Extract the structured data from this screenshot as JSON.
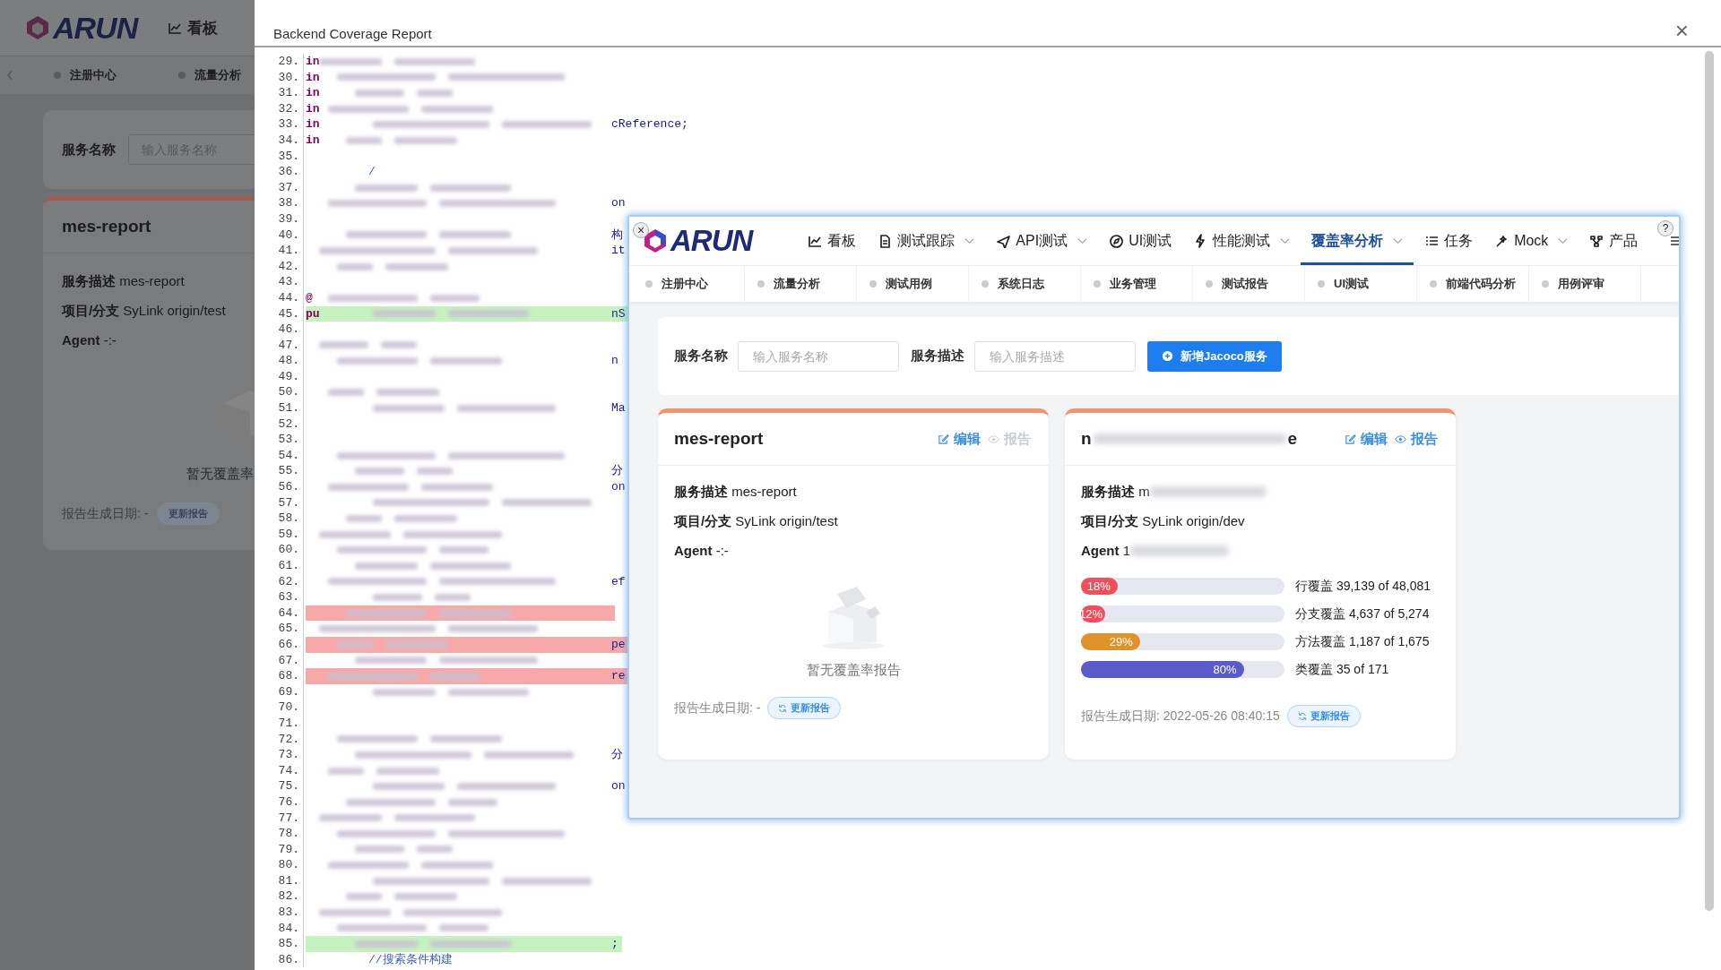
{
  "background_app": {
    "logo": "ARUN",
    "nav_item": "看板",
    "subnav": [
      "注册中心",
      "流量分析"
    ],
    "filter_label": "服务名称",
    "filter_placeholder": "输入服务名称",
    "card": {
      "title": "mes-report",
      "desc_label": "服务描述",
      "desc_value": "mes-report",
      "branch_label": "项目/分支",
      "branch_value": "SyLink origin/test",
      "agent_label": "Agent",
      "agent_value": "-:-",
      "empty_text": "暂无覆盖率",
      "date": "报告生成日期: -",
      "refresh": "更新报告"
    }
  },
  "modal": {
    "title": "Backend Coverage Report",
    "close": "×",
    "code_lines": [
      {
        "no": "29.",
        "head": "in",
        "blurred": true
      },
      {
        "no": "30.",
        "head": "in",
        "blurred": true
      },
      {
        "no": "31.",
        "head": "in",
        "blurred": true
      },
      {
        "no": "32.",
        "head": "in",
        "blurred": true
      },
      {
        "no": "33.",
        "head": "in",
        "tail": "cReference;",
        "blurred": true
      },
      {
        "no": "34.",
        "head": "in",
        "blurred": true
      },
      {
        "no": "35."
      },
      {
        "no": "36.",
        "head": "/"
      },
      {
        "no": "37.",
        "blurred": true
      },
      {
        "no": "38.",
        "tail": "on",
        "blurred": true
      },
      {
        "no": "39."
      },
      {
        "no": "40.",
        "tail": "构",
        "blurred": true
      },
      {
        "no": "41.",
        "tail": "it",
        "blurred": true
      },
      {
        "no": "42.",
        "blurred": true
      },
      {
        "no": "43."
      },
      {
        "no": "44.",
        "head": "@",
        "blurred": true
      },
      {
        "no": "45.",
        "head": "pu",
        "tail": "nS",
        "blurred": true,
        "added": true
      },
      {
        "no": "46."
      },
      {
        "no": "47.",
        "blurred": true
      },
      {
        "no": "48.",
        "tail": "n",
        "blurred": true
      },
      {
        "no": "49."
      },
      {
        "no": "50.",
        "blurred": true
      },
      {
        "no": "51.",
        "tail": "Ma",
        "blurred": true
      },
      {
        "no": "52."
      },
      {
        "no": "53."
      },
      {
        "no": "54.",
        "blurred": true
      },
      {
        "no": "55.",
        "tail": "分",
        "blurred": true
      },
      {
        "no": "56.",
        "tail": "on",
        "blurred": true
      },
      {
        "no": "57.",
        "blurred": true
      },
      {
        "no": "58.",
        "blurred": true
      },
      {
        "no": "59.",
        "blurred": true
      },
      {
        "no": "60.",
        "blurred": true
      },
      {
        "no": "61.",
        "blurred": true
      },
      {
        "no": "62.",
        "tail": "ef",
        "blurred": true
      },
      {
        "no": "63.",
        "blurred": true
      },
      {
        "no": "64.",
        "blurred": true,
        "removed": true
      },
      {
        "no": "65.",
        "blurred": true
      },
      {
        "no": "66.",
        "tail": "pe",
        "blurred": true,
        "removed": true
      },
      {
        "no": "67.",
        "blurred": true
      },
      {
        "no": "68.",
        "tail": "re",
        "blurred": true,
        "removed": true
      },
      {
        "no": "69.",
        "blurred": true
      },
      {
        "no": "70."
      },
      {
        "no": "71."
      },
      {
        "no": "72.",
        "blurred": true
      },
      {
        "no": "73.",
        "tail": "分",
        "blurred": true
      },
      {
        "no": "74.",
        "blurred": true
      },
      {
        "no": "75.",
        "tail": "on",
        "blurred": true
      },
      {
        "no": "76.",
        "blurred": true
      },
      {
        "no": "77.",
        "blurred": true
      },
      {
        "no": "78.",
        "blurred": true
      },
      {
        "no": "79.",
        "blurred": true
      },
      {
        "no": "80.",
        "blurred": true
      },
      {
        "no": "81.",
        "blurred": true
      },
      {
        "no": "82.",
        "blurred": true
      },
      {
        "no": "83.",
        "blurred": true
      },
      {
        "no": "84.",
        "blurred": true
      },
      {
        "no": "85.",
        "tail": ";",
        "blurred": true,
        "added": true
      },
      {
        "no": "86.",
        "head": "//搜索条件构建"
      }
    ]
  },
  "inset": {
    "close": "×",
    "help": "?",
    "logo": "ARUN",
    "nav": [
      {
        "label": "看板",
        "dropdown": false,
        "selected": false
      },
      {
        "label": "测试跟踪",
        "dropdown": true,
        "selected": false
      },
      {
        "label": "API测试",
        "dropdown": true,
        "selected": false
      },
      {
        "label": "UI测试",
        "dropdown": false,
        "selected": false
      },
      {
        "label": "性能测试",
        "dropdown": true,
        "selected": false
      },
      {
        "label": "覆盖率分析",
        "dropdown": true,
        "selected": true
      },
      {
        "label": "任务",
        "dropdown": false,
        "selected": false
      },
      {
        "label": "Mock",
        "dropdown": true,
        "selected": false
      },
      {
        "label": "产品",
        "dropdown": false,
        "selected": false
      }
    ],
    "subnav": [
      "注册中心",
      "流量分析",
      "测试用例",
      "系统日志",
      "业务管理",
      "测试报告",
      "UI测试",
      "前端代码分析",
      "用例评审"
    ],
    "filter": {
      "name_label": "服务名称",
      "name_placeholder": "输入服务名称",
      "desc_label": "服务描述",
      "desc_placeholder": "输入服务描述",
      "add_button": "新增Jacoco服务"
    },
    "cards": [
      {
        "kind": "empty",
        "title": "mes-report",
        "edit": "编辑",
        "report": "报告",
        "report_disabled": true,
        "redacted": false,
        "desc_label": "服务描述",
        "desc_value": "mes-report",
        "branch_label": "项目/分支",
        "branch_value": "SyLink origin/test",
        "agent_label": "Agent",
        "agent_value": "-:-",
        "empty_text": "暂无覆盖率报告",
        "date": "报告生成日期: -",
        "refresh": "更新报告"
      },
      {
        "kind": "coverage",
        "title": "n",
        "title_end": "e",
        "edit": "编辑",
        "report": "报告",
        "report_disabled": false,
        "redacted": true,
        "desc_label": "服务描述",
        "desc_value": "m",
        "branch_label": "项目/分支",
        "branch_value": "SyLink origin/dev",
        "agent_label": "Agent",
        "agent_value": "1",
        "metrics": [
          {
            "badge": "18%",
            "level": 0.18,
            "color": "#ef4f5c",
            "label": "行覆盖 39,139 of 48,081"
          },
          {
            "badge": "12%",
            "level": 0.12,
            "color": "#ef4f5c",
            "label": "分支覆盖 4,637 of 5,274"
          },
          {
            "badge": "29%",
            "level": 0.29,
            "color": "#e0922a",
            "label": "方法覆盖 1,187 of 1,675"
          },
          {
            "badge": "80%",
            "level": 0.8,
            "color": "#5a5bc9",
            "label": "类覆盖 35 of 171"
          }
        ],
        "date": "报告生成日期: 2022-05-26 08:40:15",
        "refresh": "更新报告"
      }
    ]
  }
}
